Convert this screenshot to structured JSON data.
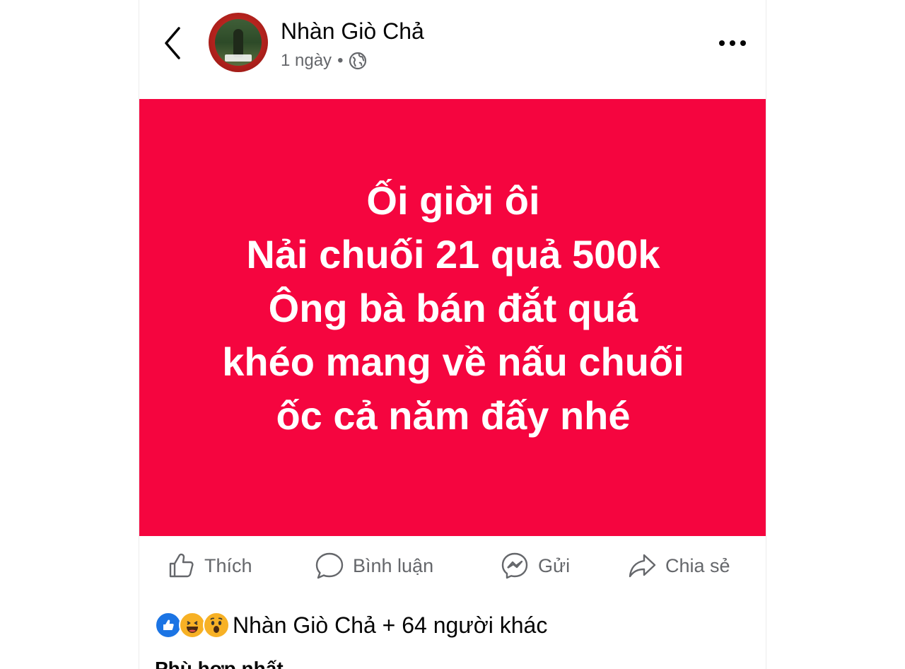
{
  "header": {
    "author_name": "Nhàn Giò Chả",
    "time": "1 ngày",
    "separator": "•",
    "privacy_icon": "globe-icon",
    "back_icon": "chevron-left-icon",
    "more_icon": "more-horizontal-icon"
  },
  "post": {
    "background_color": "#f5053f",
    "text_color": "#ffffff",
    "lines": [
      "Ối giời ôi",
      "Nải chuối 21 quả 500k",
      "Ông bà bán đắt quá",
      "khéo mang về nấu chuối",
      "ốc cả năm đấy nhé"
    ]
  },
  "actions": {
    "like": {
      "label": "Thích",
      "icon": "thumbs-up-icon"
    },
    "comment": {
      "label": "Bình luận",
      "icon": "comment-icon"
    },
    "send": {
      "label": "Gửi",
      "icon": "messenger-icon"
    },
    "share": {
      "label": "Chia sẻ",
      "icon": "share-icon"
    }
  },
  "reactions": {
    "icons": [
      "like-reaction-icon",
      "haha-reaction-icon",
      "wow-reaction-icon"
    ],
    "summary": "Nhàn Giò Chả + 64 người khác"
  },
  "comments": {
    "sort_label": "Phù hợp nhất"
  }
}
